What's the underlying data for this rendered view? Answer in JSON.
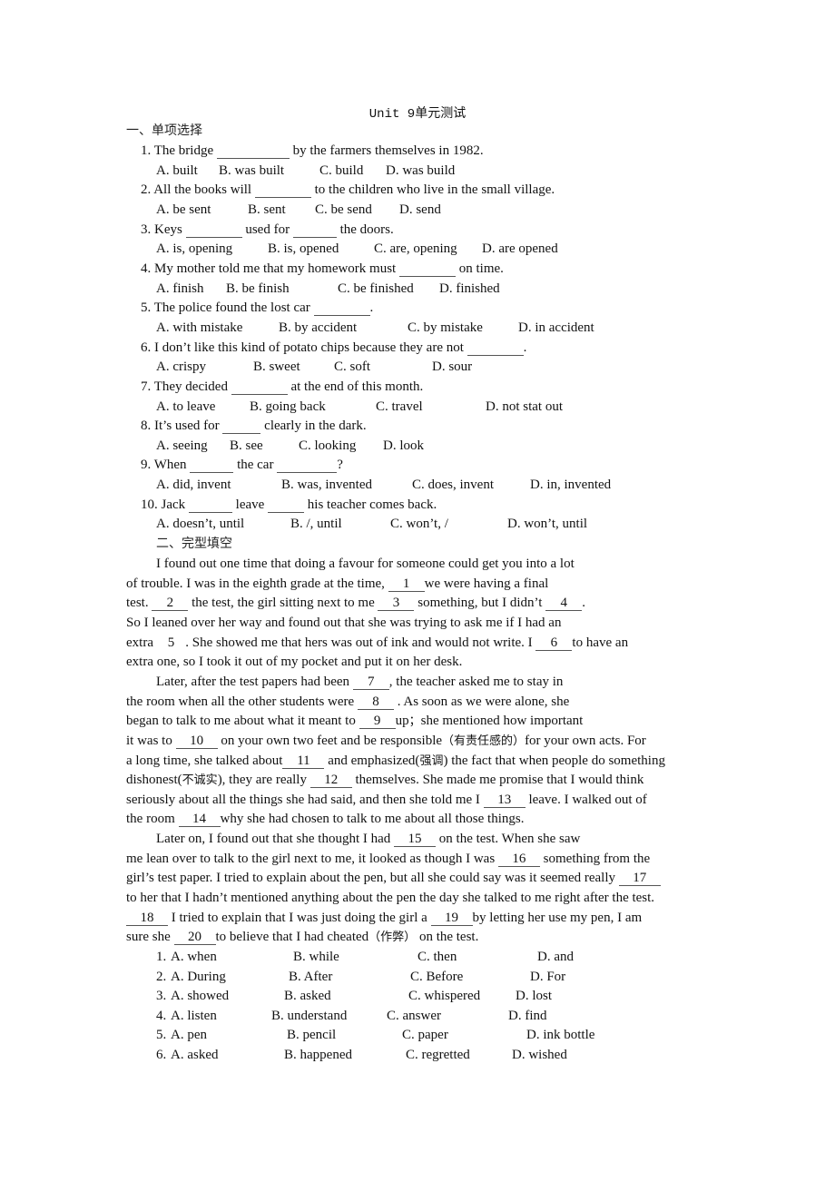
{
  "title": "Unit 9单元测试",
  "section1": {
    "heading": "一、单项选择",
    "questions": [
      {
        "num": "1.",
        "parts": [
          "The bridge ",
          " by the farmers themselves in 1982."
        ],
        "options": [
          "A. built",
          "B. was built",
          "C. build",
          "D. was build"
        ]
      },
      {
        "num": "2.",
        "parts": [
          "All the books will ",
          " to the children who live in the small village."
        ],
        "options": [
          "A. be sent",
          "B. sent",
          "C. be send",
          "D. send"
        ]
      },
      {
        "num": "3.",
        "parts": [
          "Keys ",
          " used for ",
          " the doors."
        ],
        "options": [
          "A. is, opening",
          "B. is, opened",
          "C. are, opening",
          "D. are opened"
        ]
      },
      {
        "num": "4.",
        "parts": [
          "My mother told me that my homework must ",
          " on time."
        ],
        "options": [
          "A. finish",
          "B. be finish",
          "C. be finished",
          "D. finished"
        ]
      },
      {
        "num": "5.",
        "parts": [
          "The police found the lost car ",
          "."
        ],
        "options": [
          "A. with mistake",
          "B. by accident",
          "C. by mistake",
          "D. in accident"
        ]
      },
      {
        "num": "6.",
        "parts": [
          "I don’t like this kind of potato chips because they are not ",
          "."
        ],
        "options": [
          "A. crispy",
          "B. sweet",
          "C. soft",
          "D. sour"
        ]
      },
      {
        "num": "7.",
        "parts": [
          "They decided ",
          " at the end of this month."
        ],
        "options": [
          "A. to leave",
          "B. going back",
          "C. travel",
          "D. not stat out"
        ]
      },
      {
        "num": "8.",
        "parts": [
          "It’s used for ",
          " clearly in the dark."
        ],
        "options": [
          "A. seeing",
          "B. see",
          "C. looking",
          "D. look"
        ]
      },
      {
        "num": "9.",
        "parts": [
          "When ",
          " the car ",
          "?"
        ],
        "options": [
          "A. did, invent",
          "B. was, invented",
          "C. does, invent",
          "D. in, invented"
        ]
      },
      {
        "num": "10.",
        "parts": [
          "Jack ",
          " leave ",
          " his teacher comes back."
        ],
        "options": [
          "A. doesn’t, until",
          "B. /, until",
          "C. won’t, /",
          "D. won’t, until"
        ]
      }
    ]
  },
  "section2": {
    "heading": "二、完型填空",
    "passage": [
      [
        "I found out one time that doing a favour for someone could get you into a lot"
      ],
      [
        "of trouble. I was in the eighth grade at the time, ",
        {
          "b": "1"
        },
        "we were having a final"
      ],
      [
        "test. ",
        {
          "b": "2"
        },
        "  the test, the girl sitting next to me ",
        {
          "b": "3"
        },
        " something, but I didn’t ",
        {
          "b": "4"
        },
        "."
      ],
      [
        "So I leaned over her way and found out that she was trying to ask me if I had an"
      ],
      [
        "extra ",
        {
          "b": "5",
          "plain": true
        },
        ". She showed me that hers was out of ink and would not write. I ",
        {
          "b": "6"
        },
        "to have an"
      ],
      [
        "extra one, so I took it out of my pocket and put it on her desk."
      ],
      [
        "Later, after the test papers had been ",
        {
          "b": "7"
        },
        ", the teacher asked me to stay in"
      ],
      [
        "the room when all the other students were ",
        {
          "b": "8"
        },
        " . As soon as we were alone, she"
      ],
      [
        "began to talk to me about what it meant to  ",
        {
          "b": "9"
        },
        "up；she mentioned how important"
      ],
      [
        "it was to  ",
        {
          "b": "10"
        },
        " on your own two feet and be responsible（有责任感的）for your own acts. For"
      ],
      [
        "a long time, she talked about",
        {
          "b": "11"
        },
        " and emphasized(强调) the fact that when people do something"
      ],
      [
        "dishonest(不诚实), they are really  ",
        {
          "b": "12"
        },
        " themselves. She made me promise that I would think"
      ],
      [
        "seriously about all the things she had said, and then she told me I ",
        {
          "b": "13"
        },
        " leave. I walked out of"
      ],
      [
        "the room ",
        {
          "b": "14"
        },
        "why she had chosen to talk to me about all those things."
      ],
      [
        "Later on, I found out that she thought I had  ",
        {
          "b": "15"
        },
        "  on the test. When she saw"
      ],
      [
        "me lean over to talk to the girl next to me, it looked as though I was  ",
        {
          "b": "16"
        },
        " something from the"
      ],
      [
        "girl’s test paper. I tried to explain about the pen, but all she could say was it seemed really ",
        {
          "b": "17"
        }
      ],
      [
        "to her that I hadn’t mentioned anything about the pen the day she talked to me right after the test."
      ],
      [
        {
          "b": "18"
        },
        "  I tried to explain that I was just doing the girl a ",
        {
          "b": "19"
        },
        "by letting her use my pen, I am"
      ],
      [
        "sure she ",
        {
          "b": "20"
        },
        "to believe that I had cheated（作弊） on the test."
      ]
    ],
    "options": [
      {
        "num": "1.",
        "choices": [
          "A. when",
          "B. while",
          "C. then",
          "D. and"
        ]
      },
      {
        "num": "2.",
        "choices": [
          "A. During",
          "B. After",
          "C. Before",
          "D. For"
        ]
      },
      {
        "num": "3.",
        "choices": [
          "A. showed",
          "B. asked",
          "C. whispered",
          "D. lost"
        ]
      },
      {
        "num": "4.",
        "choices": [
          "A. listen",
          "B. understand",
          "C. answer",
          "D. find"
        ]
      },
      {
        "num": "5.",
        "choices": [
          "A. pen",
          "B. pencil",
          "C. paper",
          "D. ink bottle"
        ]
      },
      {
        "num": "6.",
        "choices": [
          "A. asked",
          "B. happened",
          "C. regretted",
          "D. wished"
        ]
      }
    ]
  }
}
